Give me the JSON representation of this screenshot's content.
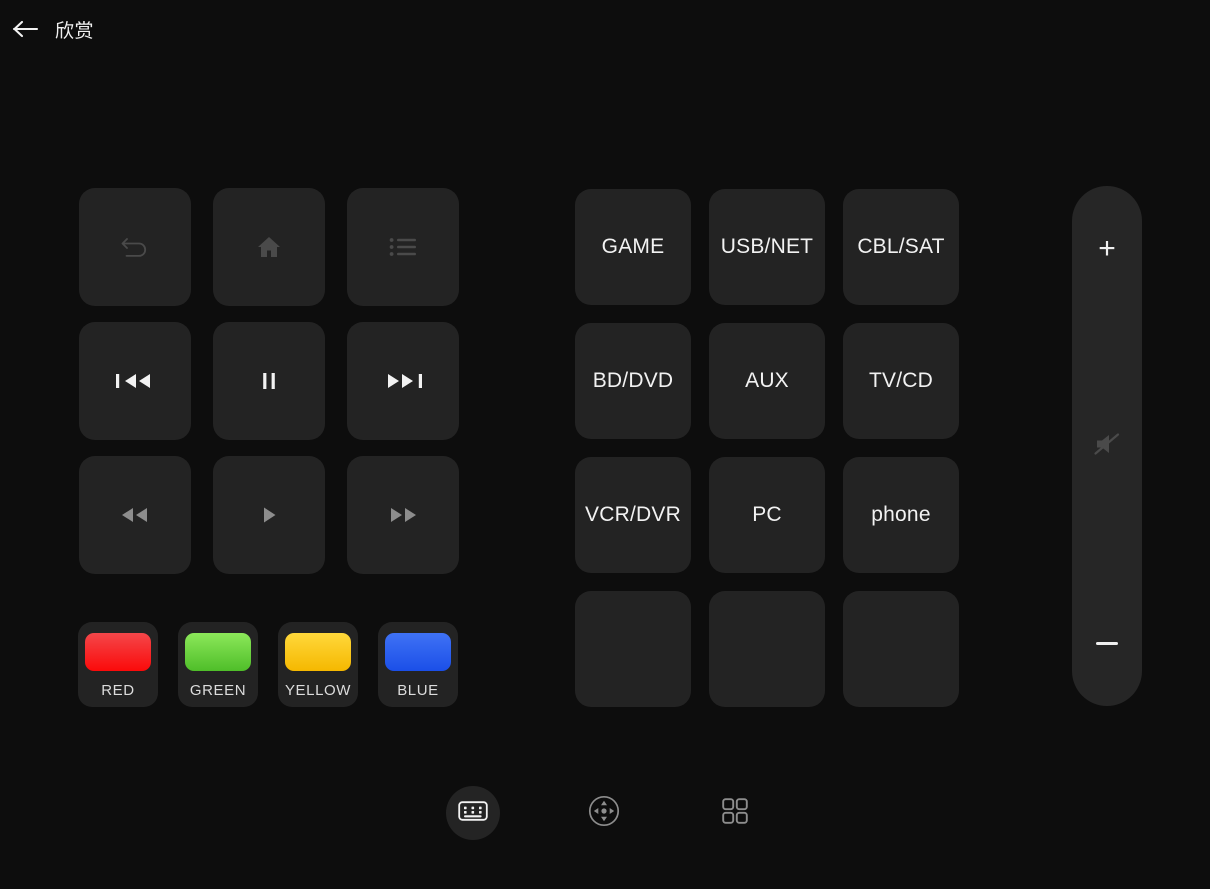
{
  "header": {
    "back_icon": "arrow-left-icon",
    "title": "欣赏"
  },
  "nav_pad": {
    "rows": [
      [
        {
          "name": "undo",
          "icon": "undo-arrow-icon",
          "tone": "faint"
        },
        {
          "name": "home",
          "icon": "home-icon",
          "tone": "faint"
        },
        {
          "name": "menu",
          "icon": "list-menu-icon",
          "tone": "faint"
        }
      ],
      [
        {
          "name": "previous-track",
          "icon": "skip-previous-icon",
          "tone": "bright"
        },
        {
          "name": "pause",
          "icon": "pause-icon",
          "tone": "bright"
        },
        {
          "name": "next-track",
          "icon": "skip-next-icon",
          "tone": "bright"
        }
      ],
      [
        {
          "name": "rewind",
          "icon": "rewind-icon",
          "tone": "mid"
        },
        {
          "name": "play",
          "icon": "play-icon",
          "tone": "mid"
        },
        {
          "name": "fast-forward",
          "icon": "fast-forward-icon",
          "tone": "mid"
        }
      ]
    ]
  },
  "color_keys": [
    {
      "label": "RED",
      "top": "#f4474a",
      "bottom": "#fb0a0a"
    },
    {
      "label": "GREEN",
      "top": "#8ce85a",
      "bottom": "#4fbe29"
    },
    {
      "label": "YELLOW",
      "top": "#ffd83b",
      "bottom": "#f5b800"
    },
    {
      "label": "BLUE",
      "top": "#3f72f5",
      "bottom": "#1b4fe8"
    }
  ],
  "source_keys": [
    {
      "label": "GAME"
    },
    {
      "label": "USB/NET"
    },
    {
      "label": "CBL/SAT"
    },
    {
      "label": "BD/DVD"
    },
    {
      "label": "AUX"
    },
    {
      "label": "TV/CD"
    },
    {
      "label": "VCR/DVR"
    },
    {
      "label": "PC"
    },
    {
      "label": "phone"
    },
    {
      "label": ""
    },
    {
      "label": ""
    },
    {
      "label": ""
    }
  ],
  "volume": {
    "up_label": "+",
    "mute_icon": "volume-mute-icon",
    "down_label": "−"
  },
  "bottom_bar": [
    {
      "name": "keyboard",
      "icon": "keyboard-icon",
      "active": true
    },
    {
      "name": "dpad",
      "icon": "dpad-icon",
      "active": false
    },
    {
      "name": "grid",
      "icon": "grid-icon",
      "active": false
    }
  ],
  "colors": {
    "background": "#0d0d0d",
    "key_fill": "#232323",
    "text": "#f2f2f2"
  }
}
